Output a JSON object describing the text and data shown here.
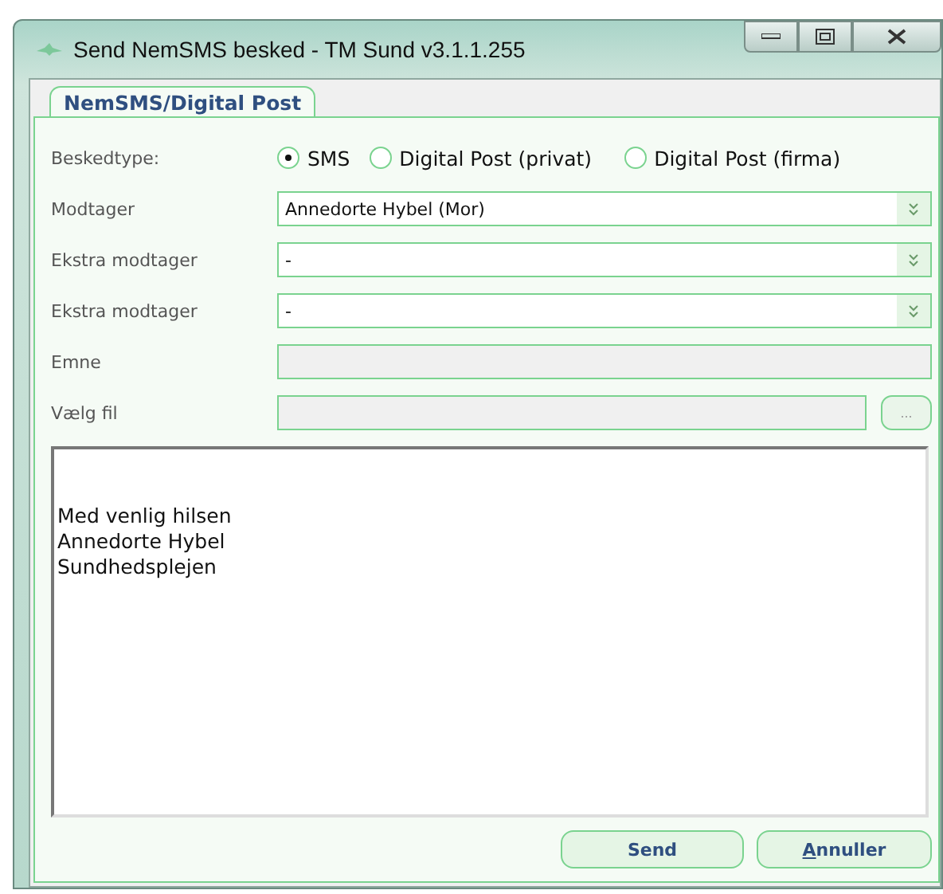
{
  "window": {
    "title": "Send NemSMS besked - TM Sund v3.1.1.255"
  },
  "tabs": [
    {
      "label": "NemSMS/Digital Post",
      "selected": true
    }
  ],
  "message_type": {
    "label": "Beskedtype:",
    "options": [
      {
        "label": "SMS",
        "selected": true
      },
      {
        "label": "Digital Post (privat)",
        "selected": false
      },
      {
        "label": "Digital Post (firma)",
        "selected": false
      }
    ]
  },
  "fields": [
    {
      "kind": "dropdown",
      "label": "Modtager",
      "value": "Annedorte Hybel (Mor)"
    },
    {
      "kind": "dropdown",
      "label": "Ekstra modtager",
      "value": "-"
    },
    {
      "kind": "dropdown",
      "label": "Ekstra modtager",
      "value": "-"
    },
    {
      "kind": "text",
      "label": "Emne"
    },
    {
      "kind": "file",
      "label": "Vælg fil",
      "button": "..."
    }
  ],
  "message_lines": [
    "Med venlig hilsen",
    "Annedorte Hybel",
    "Sundhedsplejen"
  ],
  "buttons": [
    {
      "label": "Send",
      "underline_first": false
    },
    {
      "label": "Annuller",
      "underline_first": true
    }
  ]
}
